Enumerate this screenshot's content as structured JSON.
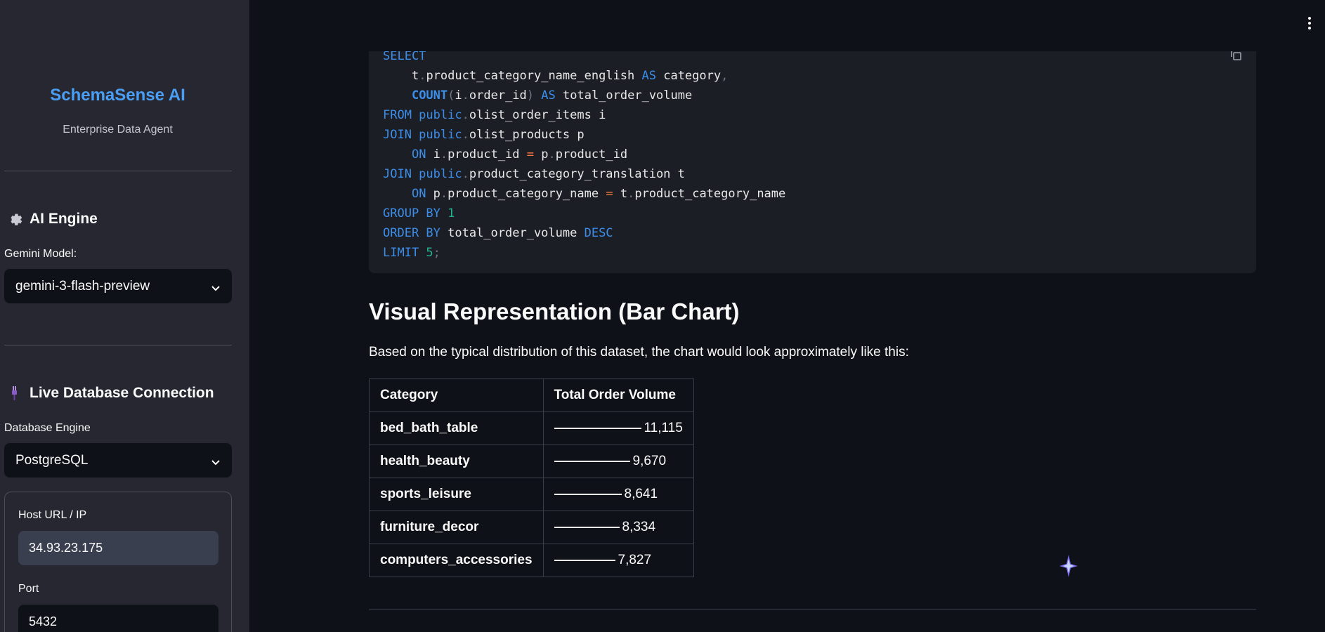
{
  "sidebar": {
    "brand_title": "SchemaSense AI",
    "brand_subtitle": "Enterprise Data Agent",
    "ai_engine": {
      "title": "AI Engine",
      "icon": "gear-icon",
      "model_label": "Gemini Model:",
      "model_value": "gemini-3-flash-preview"
    },
    "db": {
      "title": "Live Database Connection",
      "icon": "plug-icon",
      "engine_label": "Database Engine",
      "engine_value": "PostgreSQL",
      "host_label": "Host URL / IP",
      "host_value": "34.93.23.175",
      "port_label": "Port",
      "port_value": "5432"
    }
  },
  "main": {
    "sql_lines": [
      "SELECT",
      "    t.product_category_name_english AS category,",
      "    COUNT(i.order_id) AS total_order_volume",
      "FROM public.olist_order_items i",
      "JOIN public.olist_products p",
      "    ON i.product_id = p.product_id",
      "JOIN public.product_category_translation t",
      "    ON p.product_category_name = t.product_category_name",
      "GROUP BY 1",
      "ORDER BY total_order_volume DESC",
      "LIMIT 5;"
    ],
    "heading": "Visual Representation (Bar Chart)",
    "description": "Based on the typical distribution of this dataset, the chart would look approximately like this:",
    "table": {
      "headers": [
        "Category",
        "Total Order Volume"
      ],
      "rows": [
        {
          "category": "bed_bath_table",
          "volume": 11115,
          "volume_label": "11,115"
        },
        {
          "category": "health_beauty",
          "volume": 9670,
          "volume_label": "9,670"
        },
        {
          "category": "sports_leisure",
          "volume": 8641,
          "volume_label": "8,641"
        },
        {
          "category": "furniture_decor",
          "volume": 8334,
          "volume_label": "8,334"
        },
        {
          "category": "computers_accessories",
          "volume": 7827,
          "volume_label": "7,827"
        }
      ]
    }
  },
  "colors": {
    "background": "#0e1117",
    "sidebar": "#262730",
    "brand": "#4a9ff5",
    "sql_keyword": "#3b8eea",
    "sql_number": "#21b58e",
    "sql_operator": "#ff7a3d"
  }
}
